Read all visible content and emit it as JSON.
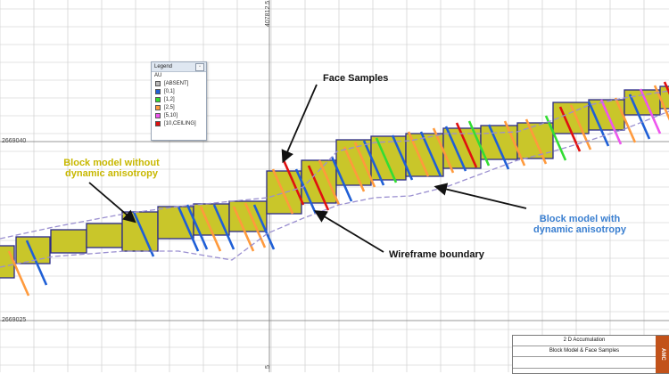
{
  "axes": {
    "x_tick_top": "407812.5",
    "x_tick_bottom": "5",
    "y_ticks": [
      "2669040",
      "2669025"
    ]
  },
  "legend": {
    "title": "Legend",
    "variable": "AU",
    "button_icon": "minimize-icon",
    "items": [
      {
        "label": "[ABSENT]",
        "color": "#b8b8b8"
      },
      {
        "label": "[0,1]",
        "color": "#1f5fd6"
      },
      {
        "label": "[1,2]",
        "color": "#33dd33"
      },
      {
        "label": "[2,5]",
        "color": "#ff9a3c"
      },
      {
        "label": "[5,10]",
        "color": "#ee55ee"
      },
      {
        "label": "[10,CEILING]",
        "color": "#e01010"
      }
    ]
  },
  "annotations": {
    "face_samples": "Face Samples",
    "block_model_without_line1": "Block model without",
    "block_model_without_line2": "dynamic anisotropy",
    "block_model_with_line1": "Block model with",
    "block_model_with_line2": "dynamic anisotropy",
    "wireframe_boundary": "Wireframe boundary"
  },
  "annotation_colors": {
    "black": "#111111",
    "yellow": "#c8b800",
    "blue": "#3a7fd0"
  },
  "title_block": {
    "heading": "2 D Accumulation",
    "subtitle": "Block Model & Face Samples",
    "logo": "AMC"
  },
  "colors": {
    "block_fill": "#c9c62a",
    "block_outline": "#2a2a8a",
    "grid": "#c8c8c8",
    "wireframe": "#9a8fd0"
  }
}
